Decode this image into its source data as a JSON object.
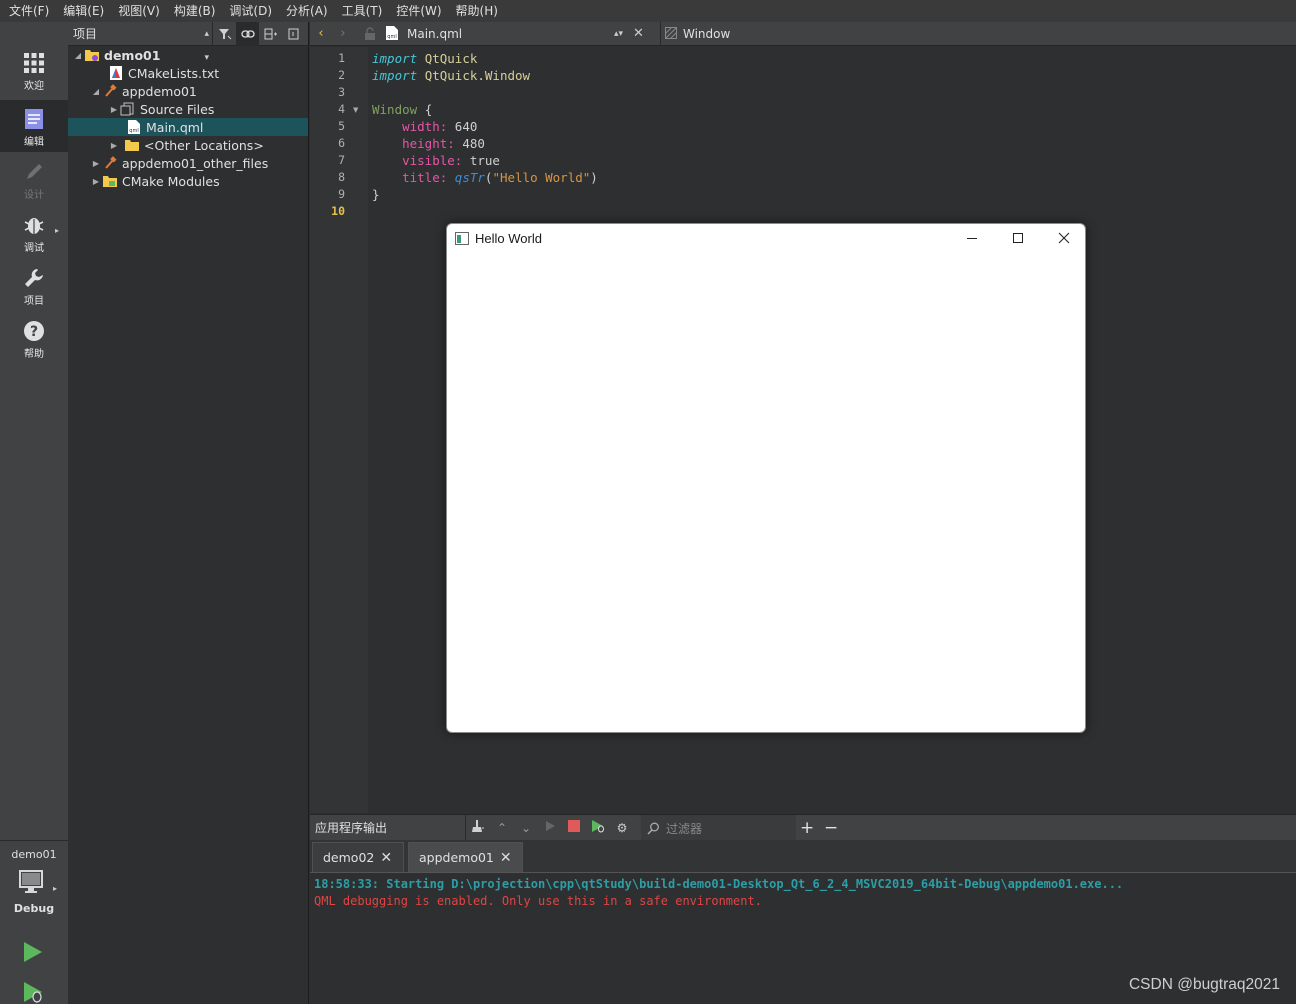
{
  "menu": [
    "文件(F)",
    "编辑(E)",
    "视图(V)",
    "构建(B)",
    "调试(D)",
    "分析(A)",
    "工具(T)",
    "控件(W)",
    "帮助(H)"
  ],
  "modes": [
    {
      "label": "欢迎",
      "icon": "grid-icon"
    },
    {
      "label": "编辑",
      "icon": "edit-doc-icon"
    },
    {
      "label": "设计",
      "icon": "pencil-icon"
    },
    {
      "label": "调试",
      "icon": "bug-icon"
    },
    {
      "label": "项目",
      "icon": "wrench-icon"
    },
    {
      "label": "帮助",
      "icon": "help-icon"
    }
  ],
  "kit": {
    "project": "demo01",
    "build": "Debug"
  },
  "project_panel": {
    "combo": "项目",
    "tree": [
      {
        "label": "demo01",
        "level": 0,
        "expanded": true,
        "bold": true,
        "icon": "project-folder-icon"
      },
      {
        "label": "CMakeLists.txt",
        "level": 1,
        "icon": "cmake-file-icon"
      },
      {
        "label": "appdemo01",
        "level": 1,
        "expanded": true,
        "icon": "hammer-icon"
      },
      {
        "label": "Source Files",
        "level": 2,
        "expanded": false,
        "icon": "source-folder-icon"
      },
      {
        "label": "Main.qml",
        "level": 2,
        "selected": true,
        "icon": "qml-file-icon"
      },
      {
        "label": "<Other Locations>",
        "level": 2,
        "expanded": false,
        "icon": "folder-icon"
      },
      {
        "label": "appdemo01_other_files",
        "level": 1,
        "expanded": false,
        "icon": "hammer-icon"
      },
      {
        "label": "CMake Modules",
        "level": 1,
        "expanded": false,
        "icon": "modules-folder-icon"
      }
    ]
  },
  "editor": {
    "file": "Main.qml",
    "symbol": "Window",
    "current_line": 10,
    "line_numbers": [
      "1",
      "2",
      "3",
      "4",
      "5",
      "6",
      "7",
      "8",
      "9",
      "10"
    ],
    "code": {
      "l1_kw": "import",
      "l1_mod": "QtQuick",
      "l2_kw": "import",
      "l2_mod": "QtQuick.Window",
      "l4_type": "Window",
      "l4_brace": "{",
      "l5_prop": "width:",
      "l5_val": "640",
      "l6_prop": "height:",
      "l6_val": "480",
      "l7_prop": "visible:",
      "l7_val": "true",
      "l8_prop": "title:",
      "l8_fn": "qsTr",
      "l8_open": "(",
      "l8_str": "\"Hello World\"",
      "l8_close": ")",
      "l9_brace": "}"
    }
  },
  "app_window": {
    "title": "Hello World"
  },
  "output": {
    "title": "应用程序输出",
    "filter_placeholder": "过滤器",
    "tabs": [
      {
        "label": "demo02",
        "active": false
      },
      {
        "label": "appdemo01",
        "active": true
      }
    ],
    "lines": [
      {
        "text": "18:58:33: Starting D:\\projection\\cpp\\qtStudy\\build-demo01-Desktop_Qt_6_2_4_MSVC2019_64bit-Debug\\appdemo01.exe...",
        "kind": "info"
      },
      {
        "text": "QML debugging is enabled. Only use this in a safe environment.",
        "kind": "error"
      }
    ]
  },
  "watermark": "CSDN @bugtraq2021",
  "colors": {
    "selection": "#1d545c",
    "accent_info": "#2d9ea6",
    "error": "#e04545",
    "run_green": "#5cb85c"
  }
}
